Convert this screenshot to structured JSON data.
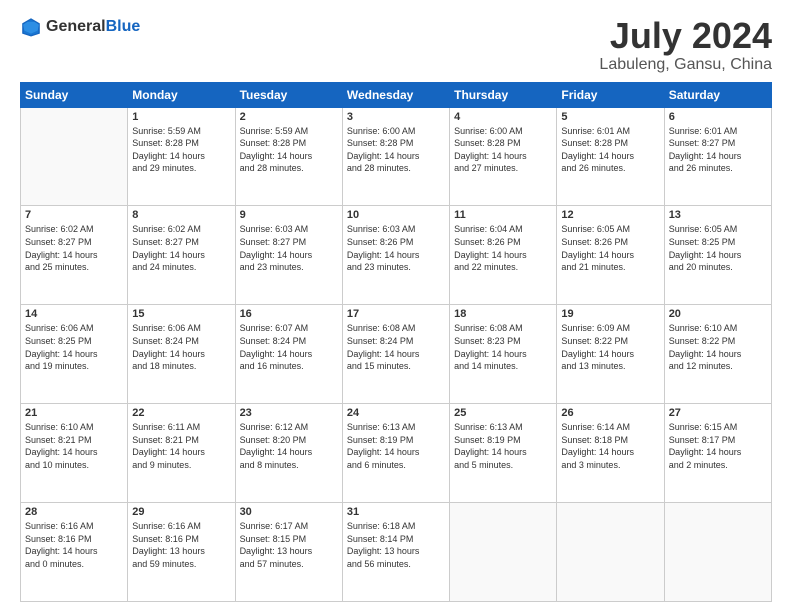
{
  "logo": {
    "general": "General",
    "blue": "Blue"
  },
  "title": "July 2024",
  "subtitle": "Labuleng, Gansu, China",
  "headers": [
    "Sunday",
    "Monday",
    "Tuesday",
    "Wednesday",
    "Thursday",
    "Friday",
    "Saturday"
  ],
  "weeks": [
    [
      {
        "day": "",
        "info": ""
      },
      {
        "day": "1",
        "info": "Sunrise: 5:59 AM\nSunset: 8:28 PM\nDaylight: 14 hours\nand 29 minutes."
      },
      {
        "day": "2",
        "info": "Sunrise: 5:59 AM\nSunset: 8:28 PM\nDaylight: 14 hours\nand 28 minutes."
      },
      {
        "day": "3",
        "info": "Sunrise: 6:00 AM\nSunset: 8:28 PM\nDaylight: 14 hours\nand 28 minutes."
      },
      {
        "day": "4",
        "info": "Sunrise: 6:00 AM\nSunset: 8:28 PM\nDaylight: 14 hours\nand 27 minutes."
      },
      {
        "day": "5",
        "info": "Sunrise: 6:01 AM\nSunset: 8:28 PM\nDaylight: 14 hours\nand 26 minutes."
      },
      {
        "day": "6",
        "info": "Sunrise: 6:01 AM\nSunset: 8:27 PM\nDaylight: 14 hours\nand 26 minutes."
      }
    ],
    [
      {
        "day": "7",
        "info": "Sunrise: 6:02 AM\nSunset: 8:27 PM\nDaylight: 14 hours\nand 25 minutes."
      },
      {
        "day": "8",
        "info": "Sunrise: 6:02 AM\nSunset: 8:27 PM\nDaylight: 14 hours\nand 24 minutes."
      },
      {
        "day": "9",
        "info": "Sunrise: 6:03 AM\nSunset: 8:27 PM\nDaylight: 14 hours\nand 23 minutes."
      },
      {
        "day": "10",
        "info": "Sunrise: 6:03 AM\nSunset: 8:26 PM\nDaylight: 14 hours\nand 23 minutes."
      },
      {
        "day": "11",
        "info": "Sunrise: 6:04 AM\nSunset: 8:26 PM\nDaylight: 14 hours\nand 22 minutes."
      },
      {
        "day": "12",
        "info": "Sunrise: 6:05 AM\nSunset: 8:26 PM\nDaylight: 14 hours\nand 21 minutes."
      },
      {
        "day": "13",
        "info": "Sunrise: 6:05 AM\nSunset: 8:25 PM\nDaylight: 14 hours\nand 20 minutes."
      }
    ],
    [
      {
        "day": "14",
        "info": "Sunrise: 6:06 AM\nSunset: 8:25 PM\nDaylight: 14 hours\nand 19 minutes."
      },
      {
        "day": "15",
        "info": "Sunrise: 6:06 AM\nSunset: 8:24 PM\nDaylight: 14 hours\nand 18 minutes."
      },
      {
        "day": "16",
        "info": "Sunrise: 6:07 AM\nSunset: 8:24 PM\nDaylight: 14 hours\nand 16 minutes."
      },
      {
        "day": "17",
        "info": "Sunrise: 6:08 AM\nSunset: 8:24 PM\nDaylight: 14 hours\nand 15 minutes."
      },
      {
        "day": "18",
        "info": "Sunrise: 6:08 AM\nSunset: 8:23 PM\nDaylight: 14 hours\nand 14 minutes."
      },
      {
        "day": "19",
        "info": "Sunrise: 6:09 AM\nSunset: 8:22 PM\nDaylight: 14 hours\nand 13 minutes."
      },
      {
        "day": "20",
        "info": "Sunrise: 6:10 AM\nSunset: 8:22 PM\nDaylight: 14 hours\nand 12 minutes."
      }
    ],
    [
      {
        "day": "21",
        "info": "Sunrise: 6:10 AM\nSunset: 8:21 PM\nDaylight: 14 hours\nand 10 minutes."
      },
      {
        "day": "22",
        "info": "Sunrise: 6:11 AM\nSunset: 8:21 PM\nDaylight: 14 hours\nand 9 minutes."
      },
      {
        "day": "23",
        "info": "Sunrise: 6:12 AM\nSunset: 8:20 PM\nDaylight: 14 hours\nand 8 minutes."
      },
      {
        "day": "24",
        "info": "Sunrise: 6:13 AM\nSunset: 8:19 PM\nDaylight: 14 hours\nand 6 minutes."
      },
      {
        "day": "25",
        "info": "Sunrise: 6:13 AM\nSunset: 8:19 PM\nDaylight: 14 hours\nand 5 minutes."
      },
      {
        "day": "26",
        "info": "Sunrise: 6:14 AM\nSunset: 8:18 PM\nDaylight: 14 hours\nand 3 minutes."
      },
      {
        "day": "27",
        "info": "Sunrise: 6:15 AM\nSunset: 8:17 PM\nDaylight: 14 hours\nand 2 minutes."
      }
    ],
    [
      {
        "day": "28",
        "info": "Sunrise: 6:16 AM\nSunset: 8:16 PM\nDaylight: 14 hours\nand 0 minutes."
      },
      {
        "day": "29",
        "info": "Sunrise: 6:16 AM\nSunset: 8:16 PM\nDaylight: 13 hours\nand 59 minutes."
      },
      {
        "day": "30",
        "info": "Sunrise: 6:17 AM\nSunset: 8:15 PM\nDaylight: 13 hours\nand 57 minutes."
      },
      {
        "day": "31",
        "info": "Sunrise: 6:18 AM\nSunset: 8:14 PM\nDaylight: 13 hours\nand 56 minutes."
      },
      {
        "day": "",
        "info": ""
      },
      {
        "day": "",
        "info": ""
      },
      {
        "day": "",
        "info": ""
      }
    ]
  ]
}
